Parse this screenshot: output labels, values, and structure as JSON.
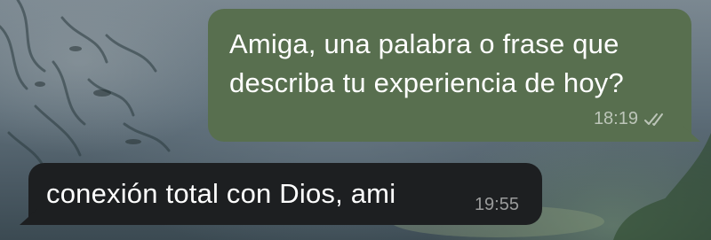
{
  "theme": {
    "outgoing_bubble_color": "#586f4f",
    "incoming_bubble_color": "#1d1f21",
    "text_color": "#ffffff",
    "meta_color": "#b9c2b4"
  },
  "messages": [
    {
      "direction": "outgoing",
      "lines": [
        "Amiga, una palabra o frase que",
        "describa tu experiencia de hoy?"
      ],
      "time": "18:19",
      "status_icon": "double-check-read-icon"
    },
    {
      "direction": "incoming",
      "text": "conexión total con Dios, ami",
      "time": "19:55"
    }
  ]
}
